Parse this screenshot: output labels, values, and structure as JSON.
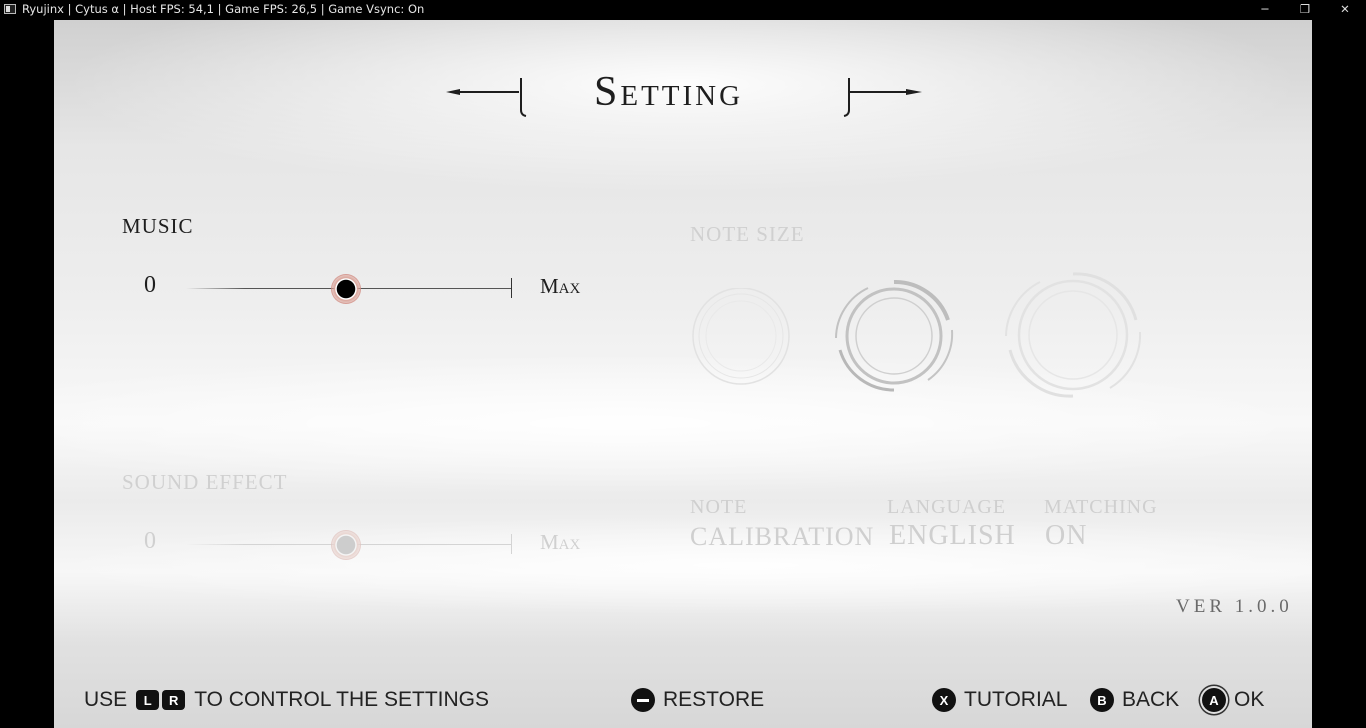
{
  "window": {
    "title": "Ryujinx | Cytus α | Host FPS: 54,1 | Game FPS: 26,5 | Game Vsync: On",
    "minimize": "─",
    "maximize": "❐",
    "close": "✕"
  },
  "screen": {
    "title": "Setting"
  },
  "music": {
    "label": "MUSIC",
    "min": "0",
    "max": "Max",
    "level": 0.49
  },
  "sound_effect": {
    "label": "SOUND EFFECT",
    "min": "0",
    "max": "Max",
    "level": 0.49
  },
  "note_size": {
    "label": "NOTE SIZE",
    "options": [
      "small",
      "medium",
      "large"
    ],
    "selected": "medium"
  },
  "note_calibration": {
    "label": "NOTE",
    "value": "CALIBRATION"
  },
  "language": {
    "label": "LANGUAGE",
    "value": "ENGLISH"
  },
  "matching": {
    "label": "MATCHING",
    "value": "ON"
  },
  "version": "VER 1.0.0",
  "footer": {
    "use": "USE",
    "l_key": "L",
    "r_key": "R",
    "control_text": "TO CONTROL THE SETTINGS",
    "restore": "RESTORE",
    "x_key": "X",
    "tutorial": "TUTORIAL",
    "b_key": "B",
    "back": "BACK",
    "a_key": "A",
    "ok": "OK"
  },
  "colors": {
    "thumb_glow": "#d58c7e",
    "active_text": "#1e1e1e",
    "inactive_text": "#d0d0d0"
  }
}
